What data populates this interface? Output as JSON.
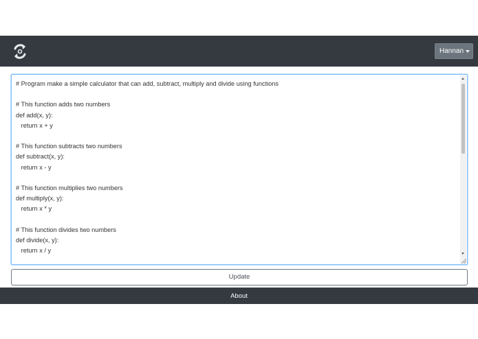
{
  "navbar": {
    "logo_icon": "sync-logo-icon",
    "user_menu": {
      "label": "Hannan",
      "icon": "caret-down-icon"
    }
  },
  "editor": {
    "code": "# Program make a simple calculator that can add, subtract, multiply and divide using functions\n\n# This function adds two numbers\ndef add(x, y):\n   return x + y\n\n# This function subtracts two numbers\ndef subtract(x, y):\n   return x - y\n\n# This function multiplies two numbers\ndef multiply(x, y):\n   return x * y\n\n# This function divides two numbers\ndef divide(x, y):\n   return x / y\n"
  },
  "actions": {
    "update_label": "Update"
  },
  "footer": {
    "about_label": "About"
  },
  "colors": {
    "navbar_bg": "#343a40",
    "dropdown_bg": "#6c757d",
    "focus_border": "#80bdff"
  }
}
